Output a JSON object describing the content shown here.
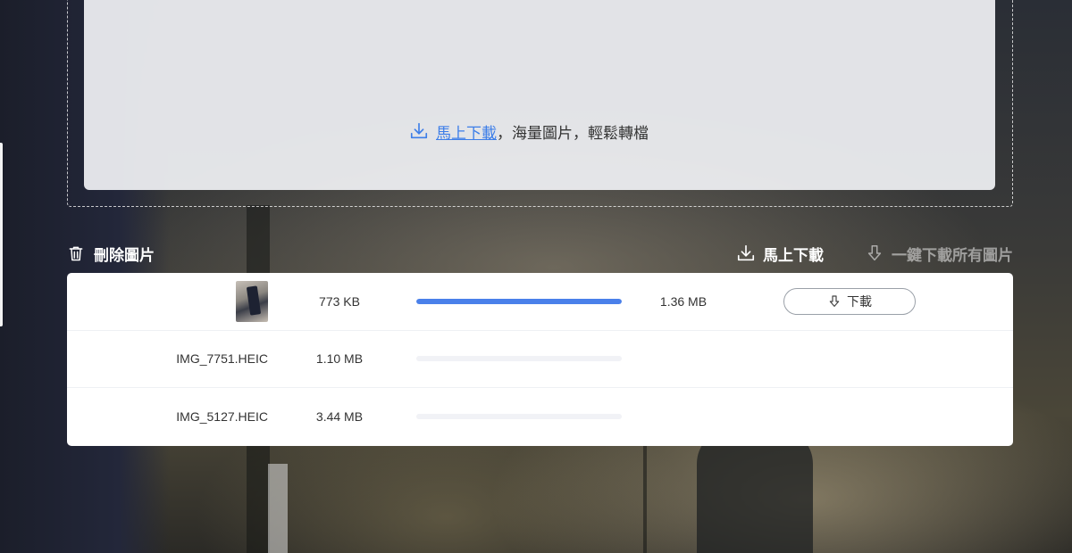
{
  "dropzone": {
    "link_text": "馬上下載",
    "rest_text": "，海量圖片，輕鬆轉檔"
  },
  "toolbar": {
    "delete_label": "刪除圖片",
    "download_now_label": "馬上下載",
    "download_all_label": "一鍵下載所有圖片"
  },
  "files": [
    {
      "name": "",
      "has_thumbnail": true,
      "size": "773 KB",
      "progress": 1.0,
      "output_size": "1.36 MB",
      "action_label": "下載"
    },
    {
      "name": "IMG_7751.HEIC",
      "has_thumbnail": false,
      "size": "1.10 MB",
      "progress": 0,
      "output_size": "",
      "action_label": ""
    },
    {
      "name": "IMG_5127.HEIC",
      "has_thumbnail": false,
      "size": "3.44 MB",
      "progress": 0,
      "output_size": "",
      "action_label": ""
    }
  ],
  "colors": {
    "accent": "#4a80ea",
    "link": "#3d7ee8"
  },
  "icons": {
    "download": "download-icon",
    "trash": "trash-icon",
    "download_arrow": "download-arrow-icon"
  }
}
